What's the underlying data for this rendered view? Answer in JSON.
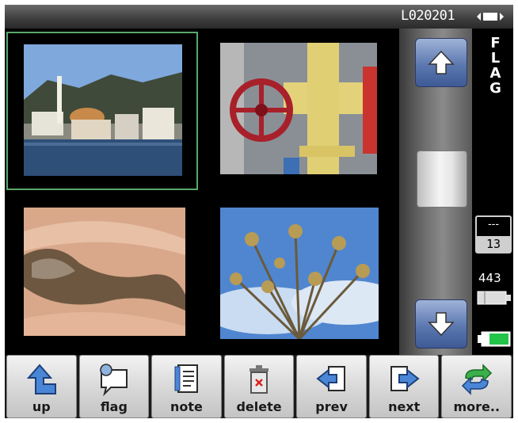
{
  "header": {
    "file_id": "L020201"
  },
  "status": {
    "flag_label": "FLAG",
    "folder_dash": "---",
    "folder_number": "13",
    "free_count": "443"
  },
  "thumbnails": [
    {
      "name": "harbor-town",
      "selected": true
    },
    {
      "name": "red-valve-pipes",
      "selected": false
    },
    {
      "name": "sand-dune-shadow",
      "selected": false
    },
    {
      "name": "dry-plant-stems",
      "selected": false
    }
  ],
  "toolbar": {
    "buttons": [
      {
        "id": "up",
        "label": "up",
        "icon": "up-turn-arrow-icon"
      },
      {
        "id": "flag",
        "label": "flag",
        "icon": "flag-bubble-icon"
      },
      {
        "id": "note",
        "label": "note",
        "icon": "note-pad-icon"
      },
      {
        "id": "delete",
        "label": "delete",
        "icon": "trash-can-icon"
      },
      {
        "id": "prev",
        "label": "prev",
        "icon": "prev-arrow-icon"
      },
      {
        "id": "next",
        "label": "next",
        "icon": "next-arrow-icon"
      },
      {
        "id": "more",
        "label": "more..",
        "icon": "cycle-arrows-icon"
      }
    ]
  },
  "colors": {
    "selection_border": "#5aa86a",
    "scroll_button": "#5c78b0",
    "icon_blue": "#4a86d6",
    "battery_green": "#22c44a"
  }
}
